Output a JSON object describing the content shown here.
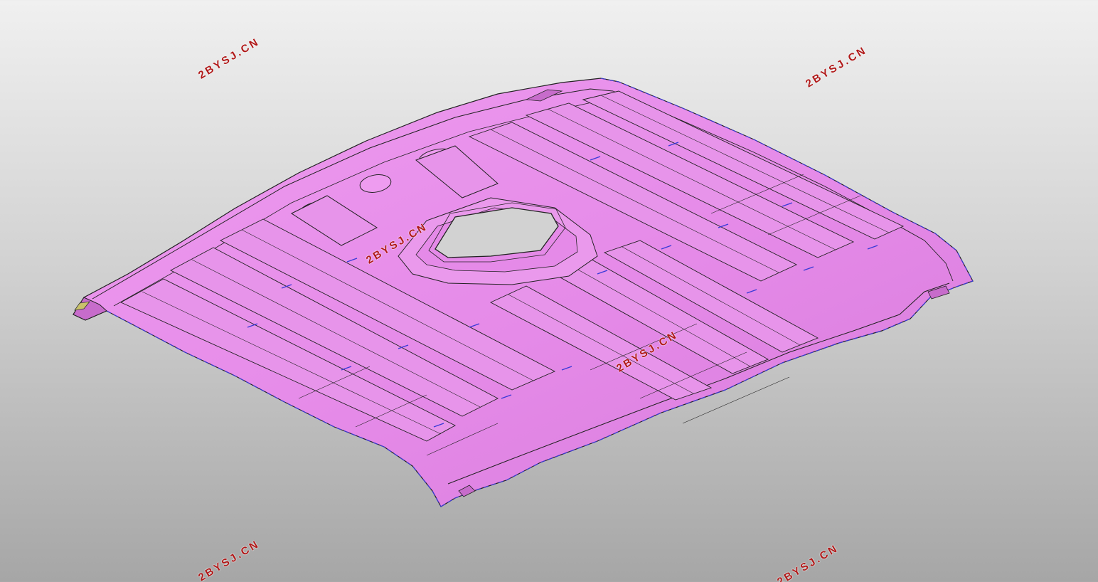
{
  "viewport": {
    "background_top": "#f0f0f0",
    "background_bottom": "#a6a6a6"
  },
  "model": {
    "surface_color": "#e58ae8",
    "surface_dark": "#c76ccb",
    "surface_light": "#f2b0f4",
    "edge_color": "#222222",
    "boundary_dash_color": "#3a3ad8",
    "cutout_color": "#d2d2d2",
    "detail_color": "#3a3ad8"
  },
  "watermarks": [
    "2BYSJ.CN",
    "2BYSJ.CN",
    "2BYSJ.CN",
    "2BYSJ.CN",
    "2BYSJ.CN",
    "2BYSJ.CN"
  ],
  "watermark_color": "#b01818"
}
